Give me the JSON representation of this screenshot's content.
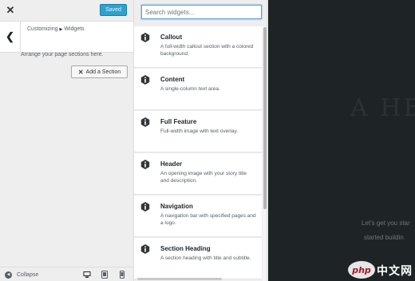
{
  "topbar": {
    "close_icon": "close-icon",
    "saved_label": "Saved",
    "saved_color": "#2ea2cc"
  },
  "section": {
    "back_icon": "chevron-left-icon",
    "breadcrumb_root": "Customizing",
    "breadcrumb_sep_icon": "triangle-right-icon",
    "breadcrumb_current": "Widgets"
  },
  "help_text": "Arrange your page sections here.",
  "add_section": {
    "icon": "x-icon",
    "label": "Add a Section"
  },
  "search": {
    "placeholder": "Search widgets..."
  },
  "widgets": [
    {
      "title": "Callout",
      "desc": "A full-width callout section with a colored background.",
      "icon": "hexagon-info-icon"
    },
    {
      "title": "Content",
      "desc": "A single-column text area.",
      "icon": "hexagon-info-icon"
    },
    {
      "title": "Full Feature",
      "desc": "Full-width image with text overlay.",
      "icon": "hexagon-info-icon"
    },
    {
      "title": "Header",
      "desc": "An opening image with your story title and description.",
      "icon": "hexagon-info-icon"
    },
    {
      "title": "Navigation",
      "desc": "A navigation bar with specified pages and a logo.",
      "icon": "hexagon-info-icon"
    },
    {
      "title": "Section Heading",
      "desc": "A section heading with title and subtitle.",
      "icon": "hexagon-info-icon"
    }
  ],
  "footer": {
    "collapse_label": "Collapse",
    "collapse_icon": "arrow-left-circle-icon",
    "devices": [
      "desktop-icon",
      "tablet-icon",
      "mobile-icon"
    ]
  },
  "preview": {
    "hero_title": "A HE",
    "line1": "Let's get you star",
    "line2": "started buildin"
  },
  "watermark": {
    "logo_text": "php",
    "text": "中文网"
  }
}
